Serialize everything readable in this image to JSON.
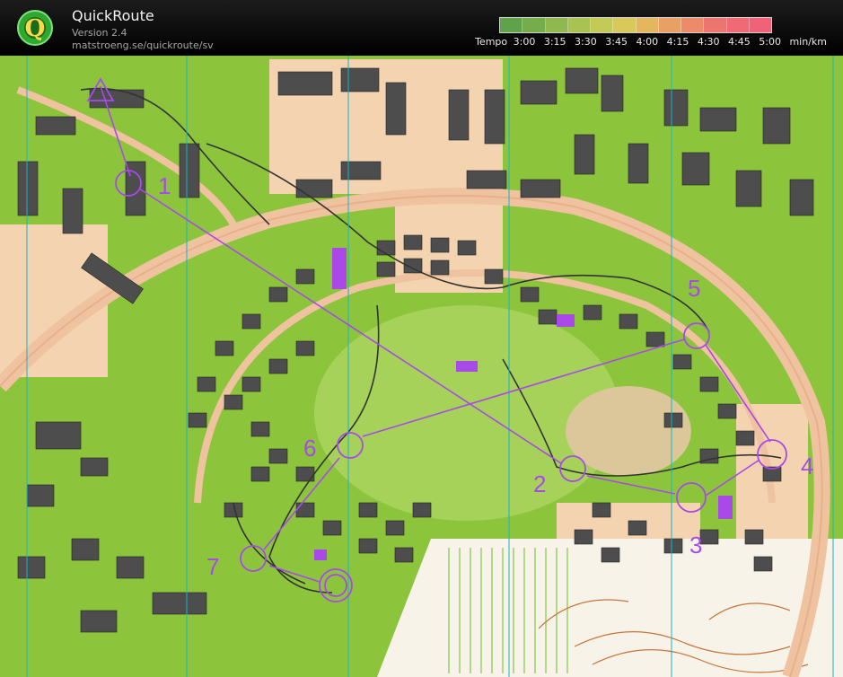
{
  "header": {
    "app_name": "QuickRoute",
    "version": "Version 2.4",
    "url": "matstroeng.se/quickroute/sv",
    "logo_letter": "Q"
  },
  "pace_legend": {
    "prefix": "Tempo",
    "ticks": [
      "3:00",
      "3:15",
      "3:30",
      "3:45",
      "4:00",
      "4:15",
      "4:30",
      "4:45",
      "5:00"
    ],
    "unit": "min/km",
    "colors": [
      "#5ea24a",
      "#76ad4c",
      "#8fb84f",
      "#a8c352",
      "#c1cb55",
      "#d9c85a",
      "#e6b65f",
      "#e9a064",
      "#ec8a6a",
      "#ee7470",
      "#ef6a74",
      "#ef6277"
    ]
  },
  "map": {
    "controls": [
      {
        "label": "1"
      },
      {
        "label": "2"
      },
      {
        "label": "3"
      },
      {
        "label": "4"
      },
      {
        "label": "5"
      },
      {
        "label": "6"
      },
      {
        "label": "7"
      },
      {
        "label": ""
      }
    ],
    "course_color": "#a94ae8",
    "colors": {
      "forest": "#8cc43c",
      "open": "#f4cfa8",
      "building": "#4a4a4a",
      "road": "#f0c8a8",
      "magnetic_north": "#1ab3c8"
    }
  }
}
